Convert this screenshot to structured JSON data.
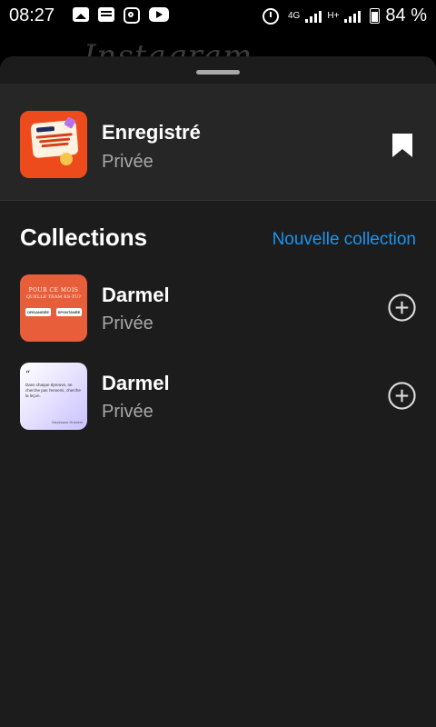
{
  "status_bar": {
    "time": "08:27",
    "network_label": "4G",
    "network_label2": "H+",
    "battery": "84 %"
  },
  "background_app": {
    "logo_text": "Instagram"
  },
  "saved": {
    "title": "Enregistré",
    "subtitle": "Privée",
    "thumbnail_icon": "promo-card-image",
    "action_icon": "bookmark-icon"
  },
  "collections_section": {
    "title": "Collections",
    "new_collection_label": "Nouvelle collection"
  },
  "collections": [
    {
      "name": "Darmel",
      "privacy": "Privée",
      "thumbnail": {
        "line1": "POUR CE MOIS",
        "line2": "QUELLE TEAM ES-TU?",
        "pill1": "ORGANISÉE",
        "pill2": "SPONTANÉE"
      },
      "action_icon": "add-circle-icon"
    },
    {
      "name": "Darmel",
      "privacy": "Privée",
      "thumbnail": {
        "quote_mark": "“",
        "text": "Dans chaque épreuve, ne cherche pas l'ennemi, cherche la leçon.",
        "author": "Meyssane Hussein"
      },
      "action_icon": "add-circle-icon"
    }
  ],
  "colors": {
    "sheet_bg": "#1c1c1c",
    "header_row_bg": "#262626",
    "accent": "#1b95f0",
    "secondary_text": "#a8a8a8"
  }
}
